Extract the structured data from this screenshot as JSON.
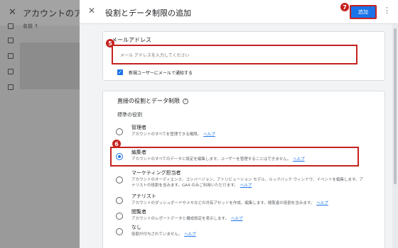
{
  "background_panel": {
    "close_icon": "close-icon",
    "title": "アカウントのアク",
    "column_header": "名前 ↑",
    "row_count": 4
  },
  "dialog": {
    "close_icon": "close-icon",
    "title": "役割とデータ制限の追加",
    "add_button_label": "追加",
    "more_icon": "vertical-dots-icon"
  },
  "badges": {
    "add_button": "7",
    "email": "5",
    "editor_role": "6"
  },
  "email_section": {
    "label": "メールアドレス",
    "input_value": "",
    "input_placeholder": "メール アドレスを入力してください",
    "notify_checked": true,
    "notify_label": "新規ユーザーにメールで通知する"
  },
  "roles_section": {
    "title": "直接の役割とデータ制限",
    "standard_roles_label": "標準の役割",
    "help_link_text": "ヘルプ",
    "roles": [
      {
        "name": "管理者",
        "description": "アカウントのすべてを管理できる権限。",
        "selected": false
      },
      {
        "name": "編集者",
        "description": "アカウントのすべてのデータと設定を編集します。ユーザーを管理することはできません。",
        "selected": true
      },
      {
        "name": "マーケティング担当者",
        "description": "アカウントのオーディエンス、コンバージョン、アトリビューション モデル、ルックバック ウィンドウ、イベントを編集します。アナリストの役割を含みます。GA4 のみご利用いただけます。",
        "selected": false
      },
      {
        "name": "アナリスト",
        "description": "アカウントのダッシュボードやメモなどの共有アセットを作成、編集します。閲覧者の役割を含みます。",
        "selected": false
      },
      {
        "name": "閲覧者",
        "description": "アカウントのレポートデータと構成設定を表示します。",
        "selected": false
      },
      {
        "name": "なし",
        "description": "役割が付与されていません。",
        "selected": false
      }
    ]
  },
  "colors": {
    "accent": "#1a73e8",
    "highlight": "#c5221f"
  }
}
